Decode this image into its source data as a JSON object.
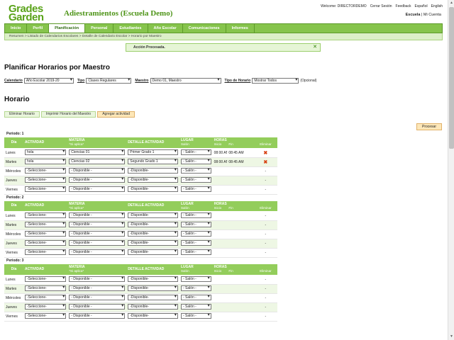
{
  "header": {
    "logo_line1": "Grades",
    "logo_line2": "Garden",
    "title": "Adiestramientos (Escuela Demo)",
    "top_links": [
      "Welcome: DIRECTORDEMO",
      "Cerrar Sesión",
      "Feedback",
      "Español",
      "English"
    ],
    "school": "Escuela",
    "my_account": "Mi Cuenta"
  },
  "nav": {
    "items": [
      "Inicio",
      "Perfil",
      "Planificación",
      "Personal",
      "Estudiantes",
      "Año Escolar",
      "Comunicaciones",
      "Informes"
    ],
    "active": "Planificación"
  },
  "breadcrumb": "Resumen  >  Listado de Calendarios Escolares  >  Detalle de Calendario Escolar  >  Horario por Maestro",
  "message": "Acción Procesada.",
  "page_title": "Planificar Horarios por Maestro",
  "filters": {
    "calendario_label": "Calendario",
    "calendario_value": "Año Escolar 2019-20",
    "tipo_label": "Tipo",
    "tipo_value": "Clases Regulares",
    "maestro_label": "Maestro",
    "maestro_value": "Demo 01, Maestro",
    "tipo_horario_label": "Tipo de Horario",
    "tipo_horario_value": "Mostrar Todos",
    "opcional": "(Opcional)"
  },
  "section_title": "Horario",
  "buttons": {
    "eliminar": "Eliminar Horario",
    "imprimir": "Imprimir Horario del Maestro",
    "agregar": "Agregar actividad",
    "procesar": "Procesar"
  },
  "columns": {
    "dia": "Día",
    "actividad": "ACTIVIDAD",
    "materia": "MATERIA",
    "materia_note": "*Si aplica*",
    "detalle": "DETALLE ACTIVIDAD",
    "lugar": "LUGAR",
    "salon": "Salón",
    "horas": "HORAS",
    "inicio": "Inicio",
    "fin": "Fin",
    "eliminar": "Eliminar"
  },
  "periods": [
    {
      "title": "Periodo: 1",
      "rows": [
        {
          "dia": "Lunes",
          "actividad": "hola",
          "materia": "Ciencias 01",
          "detalle": "Primer Grado 1",
          "salon": "- Salón -",
          "inicio": "08:00 AM",
          "fin": "08:45 AM",
          "eliminar": "✖"
        },
        {
          "dia": "Martes",
          "actividad": "hola",
          "materia": "Ciencias 02",
          "detalle": "Segundo Grado 1",
          "salon": "- Salón -",
          "inicio": "08:00 AM",
          "fin": "08:45 AM",
          "eliminar": "✖"
        },
        {
          "dia": "Miércoles",
          "actividad": "-Seleccione-",
          "materia": "- Disponible -",
          "detalle": "-Disponible-",
          "salon": "- Salón -",
          "inicio": "",
          "fin": "",
          "eliminar": "-"
        },
        {
          "dia": "Jueves",
          "actividad": "-Seleccione-",
          "materia": "- Disponible -",
          "detalle": "-Disponible-",
          "salon": "- Salón -",
          "inicio": "",
          "fin": "",
          "eliminar": "-"
        },
        {
          "dia": "Viernes",
          "actividad": "-Seleccione-",
          "materia": "- Disponible -",
          "detalle": "-Disponible-",
          "salon": "- Salón -",
          "inicio": "",
          "fin": "",
          "eliminar": "-"
        }
      ]
    },
    {
      "title": "Periodo: 2",
      "rows": [
        {
          "dia": "Lunes",
          "actividad": "-Seleccione-",
          "materia": "- Disponible -",
          "detalle": "-Disponible-",
          "salon": "- Salón -",
          "inicio": "",
          "fin": "",
          "eliminar": "-"
        },
        {
          "dia": "Martes",
          "actividad": "-Seleccione-",
          "materia": "- Disponible -",
          "detalle": "-Disponible-",
          "salon": "- Salón -",
          "inicio": "",
          "fin": "",
          "eliminar": "-"
        },
        {
          "dia": "Miércoles",
          "actividad": "-Seleccione-",
          "materia": "- Disponible -",
          "detalle": "-Disponible-",
          "salon": "- Salón -",
          "inicio": "",
          "fin": "",
          "eliminar": "-"
        },
        {
          "dia": "Jueves",
          "actividad": "-Seleccione-",
          "materia": "- Disponible -",
          "detalle": "-Disponible-",
          "salon": "- Salón -",
          "inicio": "",
          "fin": "",
          "eliminar": "-"
        },
        {
          "dia": "Viernes",
          "actividad": "-Seleccione-",
          "materia": "- Disponible -",
          "detalle": "-Disponible-",
          "salon": "- Salón -",
          "inicio": "",
          "fin": "",
          "eliminar": "-"
        }
      ]
    },
    {
      "title": "Periodo: 3",
      "rows": [
        {
          "dia": "Lunes",
          "actividad": "-Seleccione-",
          "materia": "- Disponible -",
          "detalle": "-Disponible-",
          "salon": "- Salón -",
          "inicio": "",
          "fin": "",
          "eliminar": "-"
        },
        {
          "dia": "Martes",
          "actividad": "-Seleccione-",
          "materia": "- Disponible -",
          "detalle": "-Disponible-",
          "salon": "- Salón -",
          "inicio": "",
          "fin": "",
          "eliminar": "-"
        },
        {
          "dia": "Miércoles",
          "actividad": "-Seleccione-",
          "materia": "- Disponible -",
          "detalle": "-Disponible-",
          "salon": "- Salón -",
          "inicio": "",
          "fin": "",
          "eliminar": "-"
        },
        {
          "dia": "Jueves",
          "actividad": "-Seleccione-",
          "materia": "- Disponible -",
          "detalle": "-Disponible-",
          "salon": "- Salón -",
          "inicio": "",
          "fin": "",
          "eliminar": "-"
        },
        {
          "dia": "Viernes",
          "actividad": "-Seleccione-",
          "materia": "- Disponible -",
          "detalle": "-Disponible-",
          "salon": "- Salón -",
          "inicio": "",
          "fin": "",
          "eliminar": "-"
        }
      ]
    }
  ],
  "colors": {
    "brand_green": "#5aa31a",
    "nav_green": "#86c44c",
    "header_green": "#93cd5b",
    "row_alt": "#eef7e4",
    "delete_red": "#d84315",
    "accent_orange": "#fde7b8"
  }
}
